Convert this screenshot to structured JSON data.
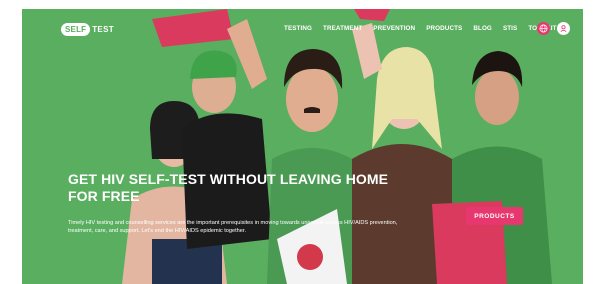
{
  "brand": {
    "badge": "SELF",
    "word": "TEST"
  },
  "nav": {
    "items": [
      "TESTING",
      "TREATMENT",
      "PREVENTION",
      "PRODUCTS",
      "BLOG",
      "STIS",
      "TOOLKIT"
    ]
  },
  "icons": {
    "language": "globe-icon",
    "account": "user-icon"
  },
  "hero": {
    "title": "GET HIV SELF-TEST WITHOUT LEAVING HOME FOR FREE",
    "body": "Timely HIV testing and counselling services are the important prerequisites in moving towards universal access HIV/AIDS prevention, treatment, care, and support. Let's end the HIV/AIDS epidemic together.",
    "cta": "PRODUCTS"
  },
  "colors": {
    "background": "#5aae5f",
    "accent": "#e6386f",
    "text": "#ffffff"
  }
}
